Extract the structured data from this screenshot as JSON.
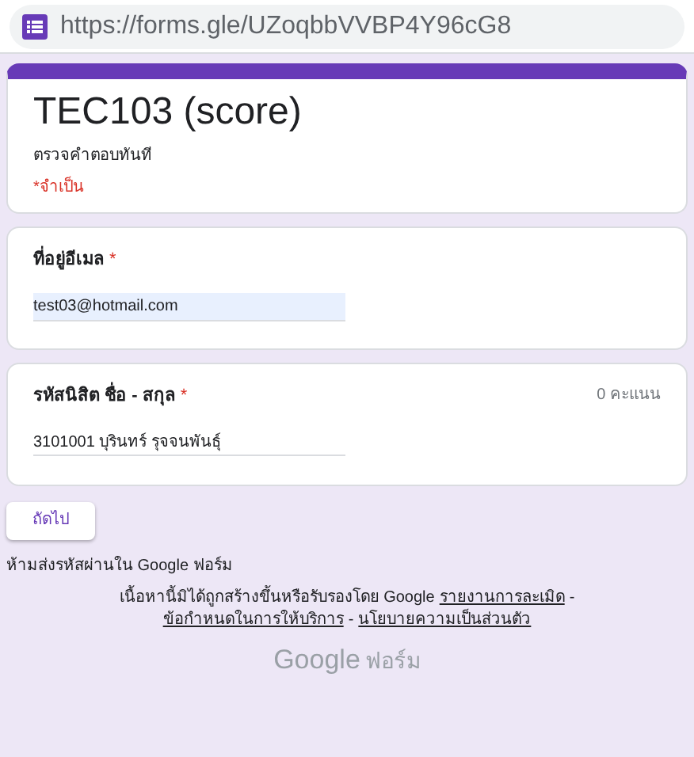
{
  "address_bar": {
    "url": "https://forms.gle/UZoqbbVVBP4Y96cG8"
  },
  "header": {
    "title": "TEC103 (score)",
    "description": "ตรวจคำตอบทันที",
    "required_note": "*จำเป็น"
  },
  "questions": [
    {
      "label": "ที่อยู่อีเมล",
      "required_mark": "*",
      "value": "test03@hotmail.com",
      "autofilled": true
    },
    {
      "label": "รหัสนิสิต ชื่อ - สกุล",
      "required_mark": "*",
      "points": "0 คะแนน",
      "value": "3101001 บุรินทร์ รุจจนพันธุ์",
      "autofilled": false
    }
  ],
  "next_button": "ถัดไป",
  "password_warning": "ห้ามส่งรหัสผ่านใน Google ฟอร์ม",
  "disclaimer": {
    "text": "เนื้อหานี้มิได้ถูกสร้างขึ้นหรือรับรองโดย Google",
    "links": [
      "รายงานการละเมิด",
      "ข้อกำหนดในการให้บริการ",
      "นโยบายความเป็นส่วนตัว"
    ],
    "separator": "-"
  },
  "logo": {
    "brand": "Google",
    "product": "ฟอร์ม"
  }
}
